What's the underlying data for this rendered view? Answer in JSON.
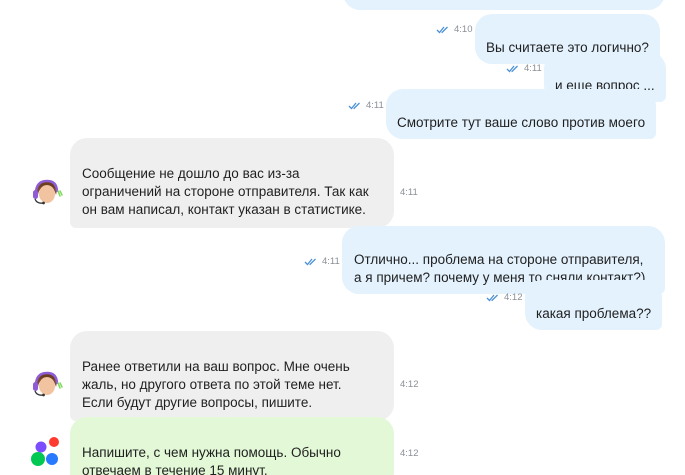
{
  "chat": {
    "messages": [
      {
        "id": "m1",
        "direction": "outgoing",
        "text": "Вы считаете это логично?",
        "time": "4:10",
        "status": "read"
      },
      {
        "id": "m2",
        "direction": "outgoing",
        "text": "и еще вопрос ...",
        "time": "4:11",
        "status": "read"
      },
      {
        "id": "m3",
        "direction": "outgoing",
        "text": "Смотрите тут ваше слово против моего",
        "time": "4:11",
        "status": "read"
      },
      {
        "id": "m4",
        "direction": "incoming",
        "text": "Сообщение не дошло до вас из-за\nограничений на стороне отправителя. Так как\nон вам написал, контакт указан в статистике.",
        "time": "4:11",
        "avatar": "support-agent-avatar"
      },
      {
        "id": "m5",
        "direction": "outgoing",
        "text": "Отлично... проблема на стороне отправителя,\nа я причем? почему у меня то сняли контакт?)",
        "time": "4:11",
        "status": "read"
      },
      {
        "id": "m6",
        "direction": "outgoing",
        "text": "какая проблема??",
        "time": "4:12",
        "status": "read"
      },
      {
        "id": "m7",
        "direction": "incoming",
        "text": "Ранее ответили на ваш вопрос. Мне очень\nжаль, но другого ответа по этой теме нет.\nЕсли будут другие вопросы, пишите.",
        "time": "4:12",
        "avatar": "support-agent-avatar"
      },
      {
        "id": "m8",
        "direction": "incoming",
        "text": "Напишите, с чем нужна помощь. Обычно\nотвечаем в течение 15 минут.",
        "time": "4:12",
        "avatar": "app-logo",
        "style": "system-green"
      }
    ]
  },
  "colors": {
    "outgoing_bubble": "#e3f2fd",
    "incoming_bubble": "#efefef",
    "system_bubble": "#e2f8d6",
    "read_ticks": "#4a90d9",
    "time_text": "#8a8f96"
  }
}
